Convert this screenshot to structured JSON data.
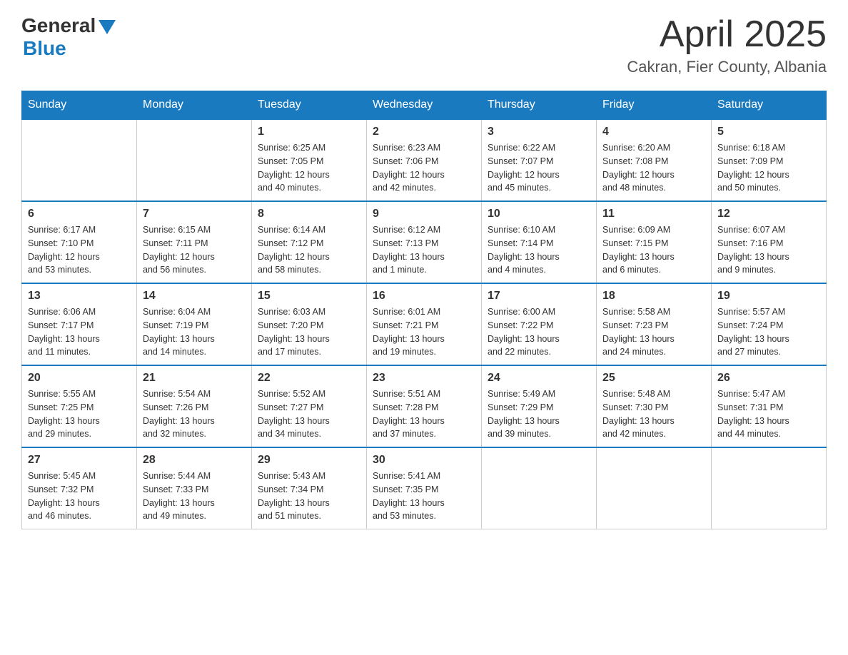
{
  "header": {
    "logo_general": "General",
    "logo_blue": "Blue",
    "month_title": "April 2025",
    "location": "Cakran, Fier County, Albania"
  },
  "days_of_week": [
    "Sunday",
    "Monday",
    "Tuesday",
    "Wednesday",
    "Thursday",
    "Friday",
    "Saturday"
  ],
  "weeks": [
    [
      {
        "day": "",
        "info": ""
      },
      {
        "day": "",
        "info": ""
      },
      {
        "day": "1",
        "info": "Sunrise: 6:25 AM\nSunset: 7:05 PM\nDaylight: 12 hours\nand 40 minutes."
      },
      {
        "day": "2",
        "info": "Sunrise: 6:23 AM\nSunset: 7:06 PM\nDaylight: 12 hours\nand 42 minutes."
      },
      {
        "day": "3",
        "info": "Sunrise: 6:22 AM\nSunset: 7:07 PM\nDaylight: 12 hours\nand 45 minutes."
      },
      {
        "day": "4",
        "info": "Sunrise: 6:20 AM\nSunset: 7:08 PM\nDaylight: 12 hours\nand 48 minutes."
      },
      {
        "day": "5",
        "info": "Sunrise: 6:18 AM\nSunset: 7:09 PM\nDaylight: 12 hours\nand 50 minutes."
      }
    ],
    [
      {
        "day": "6",
        "info": "Sunrise: 6:17 AM\nSunset: 7:10 PM\nDaylight: 12 hours\nand 53 minutes."
      },
      {
        "day": "7",
        "info": "Sunrise: 6:15 AM\nSunset: 7:11 PM\nDaylight: 12 hours\nand 56 minutes."
      },
      {
        "day": "8",
        "info": "Sunrise: 6:14 AM\nSunset: 7:12 PM\nDaylight: 12 hours\nand 58 minutes."
      },
      {
        "day": "9",
        "info": "Sunrise: 6:12 AM\nSunset: 7:13 PM\nDaylight: 13 hours\nand 1 minute."
      },
      {
        "day": "10",
        "info": "Sunrise: 6:10 AM\nSunset: 7:14 PM\nDaylight: 13 hours\nand 4 minutes."
      },
      {
        "day": "11",
        "info": "Sunrise: 6:09 AM\nSunset: 7:15 PM\nDaylight: 13 hours\nand 6 minutes."
      },
      {
        "day": "12",
        "info": "Sunrise: 6:07 AM\nSunset: 7:16 PM\nDaylight: 13 hours\nand 9 minutes."
      }
    ],
    [
      {
        "day": "13",
        "info": "Sunrise: 6:06 AM\nSunset: 7:17 PM\nDaylight: 13 hours\nand 11 minutes."
      },
      {
        "day": "14",
        "info": "Sunrise: 6:04 AM\nSunset: 7:19 PM\nDaylight: 13 hours\nand 14 minutes."
      },
      {
        "day": "15",
        "info": "Sunrise: 6:03 AM\nSunset: 7:20 PM\nDaylight: 13 hours\nand 17 minutes."
      },
      {
        "day": "16",
        "info": "Sunrise: 6:01 AM\nSunset: 7:21 PM\nDaylight: 13 hours\nand 19 minutes."
      },
      {
        "day": "17",
        "info": "Sunrise: 6:00 AM\nSunset: 7:22 PM\nDaylight: 13 hours\nand 22 minutes."
      },
      {
        "day": "18",
        "info": "Sunrise: 5:58 AM\nSunset: 7:23 PM\nDaylight: 13 hours\nand 24 minutes."
      },
      {
        "day": "19",
        "info": "Sunrise: 5:57 AM\nSunset: 7:24 PM\nDaylight: 13 hours\nand 27 minutes."
      }
    ],
    [
      {
        "day": "20",
        "info": "Sunrise: 5:55 AM\nSunset: 7:25 PM\nDaylight: 13 hours\nand 29 minutes."
      },
      {
        "day": "21",
        "info": "Sunrise: 5:54 AM\nSunset: 7:26 PM\nDaylight: 13 hours\nand 32 minutes."
      },
      {
        "day": "22",
        "info": "Sunrise: 5:52 AM\nSunset: 7:27 PM\nDaylight: 13 hours\nand 34 minutes."
      },
      {
        "day": "23",
        "info": "Sunrise: 5:51 AM\nSunset: 7:28 PM\nDaylight: 13 hours\nand 37 minutes."
      },
      {
        "day": "24",
        "info": "Sunrise: 5:49 AM\nSunset: 7:29 PM\nDaylight: 13 hours\nand 39 minutes."
      },
      {
        "day": "25",
        "info": "Sunrise: 5:48 AM\nSunset: 7:30 PM\nDaylight: 13 hours\nand 42 minutes."
      },
      {
        "day": "26",
        "info": "Sunrise: 5:47 AM\nSunset: 7:31 PM\nDaylight: 13 hours\nand 44 minutes."
      }
    ],
    [
      {
        "day": "27",
        "info": "Sunrise: 5:45 AM\nSunset: 7:32 PM\nDaylight: 13 hours\nand 46 minutes."
      },
      {
        "day": "28",
        "info": "Sunrise: 5:44 AM\nSunset: 7:33 PM\nDaylight: 13 hours\nand 49 minutes."
      },
      {
        "day": "29",
        "info": "Sunrise: 5:43 AM\nSunset: 7:34 PM\nDaylight: 13 hours\nand 51 minutes."
      },
      {
        "day": "30",
        "info": "Sunrise: 5:41 AM\nSunset: 7:35 PM\nDaylight: 13 hours\nand 53 minutes."
      },
      {
        "day": "",
        "info": ""
      },
      {
        "day": "",
        "info": ""
      },
      {
        "day": "",
        "info": ""
      }
    ]
  ]
}
